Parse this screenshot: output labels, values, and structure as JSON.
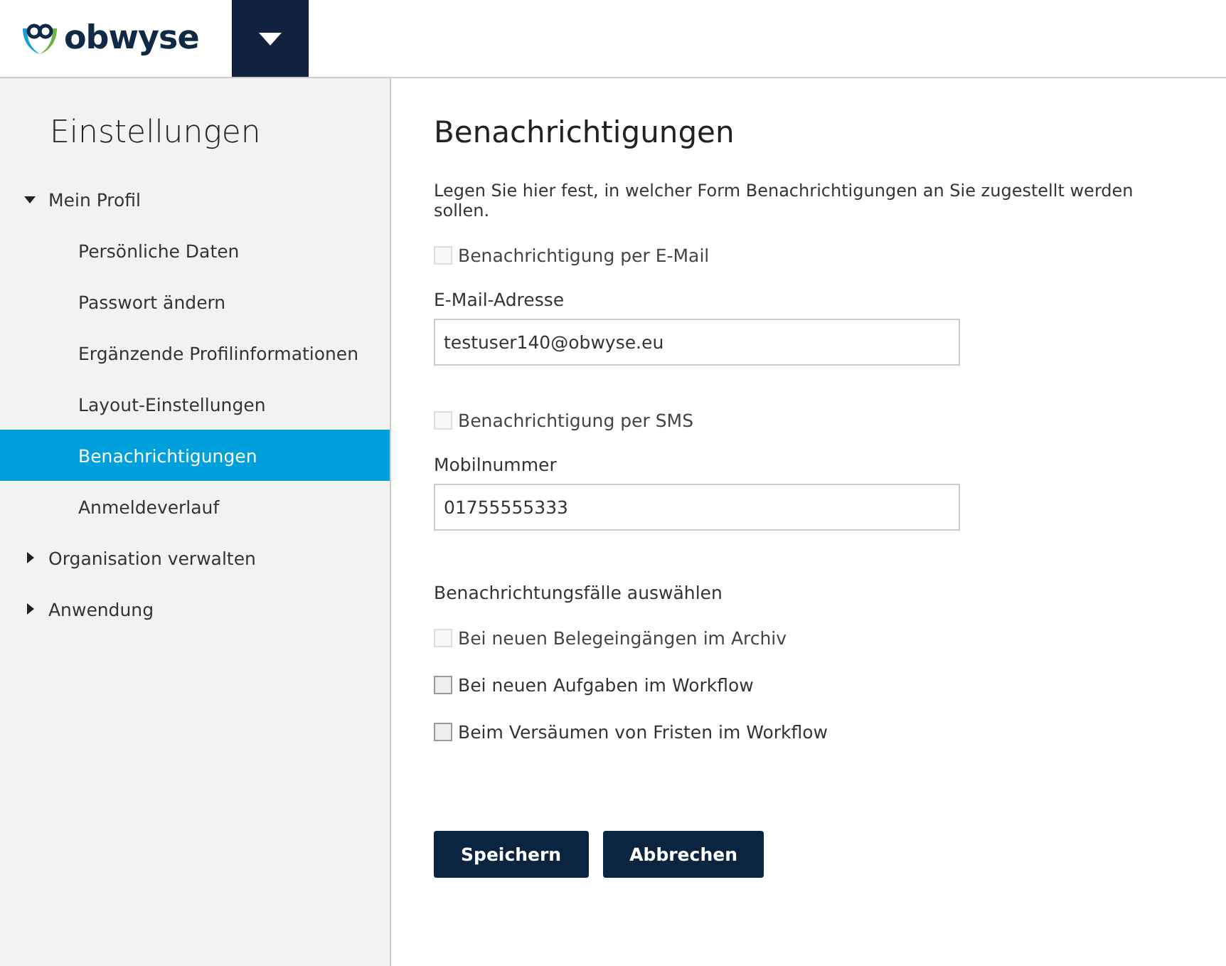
{
  "header": {
    "logo": "obwyse"
  },
  "sidebar": {
    "title": "Einstellungen",
    "items": [
      {
        "label": "Mein Profil",
        "expanded": true,
        "selected": false,
        "children": [
          {
            "label": "Persönliche Daten",
            "selected": false
          },
          {
            "label": "Passwort ändern",
            "selected": false
          },
          {
            "label": "Ergänzende Profilinformationen",
            "selected": false
          },
          {
            "label": "Layout-Einstellungen",
            "selected": false
          },
          {
            "label": "Benachrichtigungen",
            "selected": true
          },
          {
            "label": "Anmeldeverlauf",
            "selected": false
          }
        ]
      },
      {
        "label": "Organisation verwalten",
        "expanded": false,
        "selected": false
      },
      {
        "label": "Anwendung",
        "expanded": false,
        "selected": false
      }
    ]
  },
  "main": {
    "title": "Benachrichtigungen",
    "intro": "Legen Sie hier fest, in welcher Form Benachrichtigungen an Sie zugestellt werden sollen.",
    "email": {
      "checkbox": {
        "label": "Benachrichtigung per E-Mail",
        "checked": false,
        "disabled": true
      },
      "field_label": "E-Mail-Adresse",
      "value": "testuser140@obwyse.eu"
    },
    "sms": {
      "checkbox": {
        "label": "Benachrichtigung per SMS",
        "checked": false,
        "disabled": true
      },
      "field_label": "Mobilnummer",
      "value": "01755555333"
    },
    "cases_title": "Benachrichtungsfälle auswählen",
    "cases": [
      {
        "label": "Bei neuen Belegeingängen im Archiv",
        "checked": false,
        "disabled": true
      },
      {
        "label": "Bei neuen Aufgaben im Workflow",
        "checked": false,
        "disabled": false
      },
      {
        "label": "Beim Versäumen von Fristen im Workflow",
        "checked": false,
        "disabled": false
      }
    ],
    "buttons": [
      "Speichern",
      "Abbrechen"
    ]
  }
}
